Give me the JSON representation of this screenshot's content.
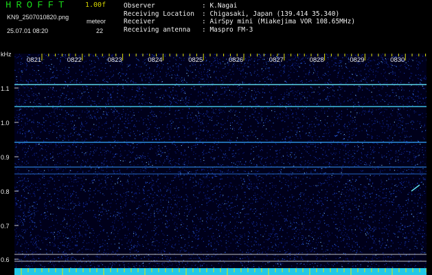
{
  "header": {
    "app_title": "HROFFT",
    "version": "1.00f",
    "filename": "KN9_2507010820.png",
    "mode": "meteor",
    "timestamp": "25.07.01 08:20",
    "count": "22"
  },
  "info": {
    "rows": [
      {
        "label": "Observer",
        "value": ": K.Nagai"
      },
      {
        "label": "Receiving Location",
        "value": ": Chigasaki, Japan (139.414 35.340)"
      },
      {
        "label": "Receiver",
        "value": ": AirSpy mini (Miakejima VOR 108.65MHz)"
      },
      {
        "label": "Receiving antenna",
        "value": ": Maspro FM-3"
      }
    ]
  },
  "axis": {
    "unit": "kHz",
    "y_ticks": [
      "1.1",
      "1.0",
      "0.9",
      "0.8",
      "0.7",
      "0.6"
    ],
    "x_ticks": [
      "0821",
      "0822",
      "0823",
      "0824",
      "0825",
      "0826",
      "0827",
      "0828",
      "0829",
      "0830"
    ]
  },
  "colors": {
    "background": "#00001a",
    "title_green": "#19d419",
    "tick_yellow": "#e8e800",
    "carrier": "#5ad6e6"
  }
}
